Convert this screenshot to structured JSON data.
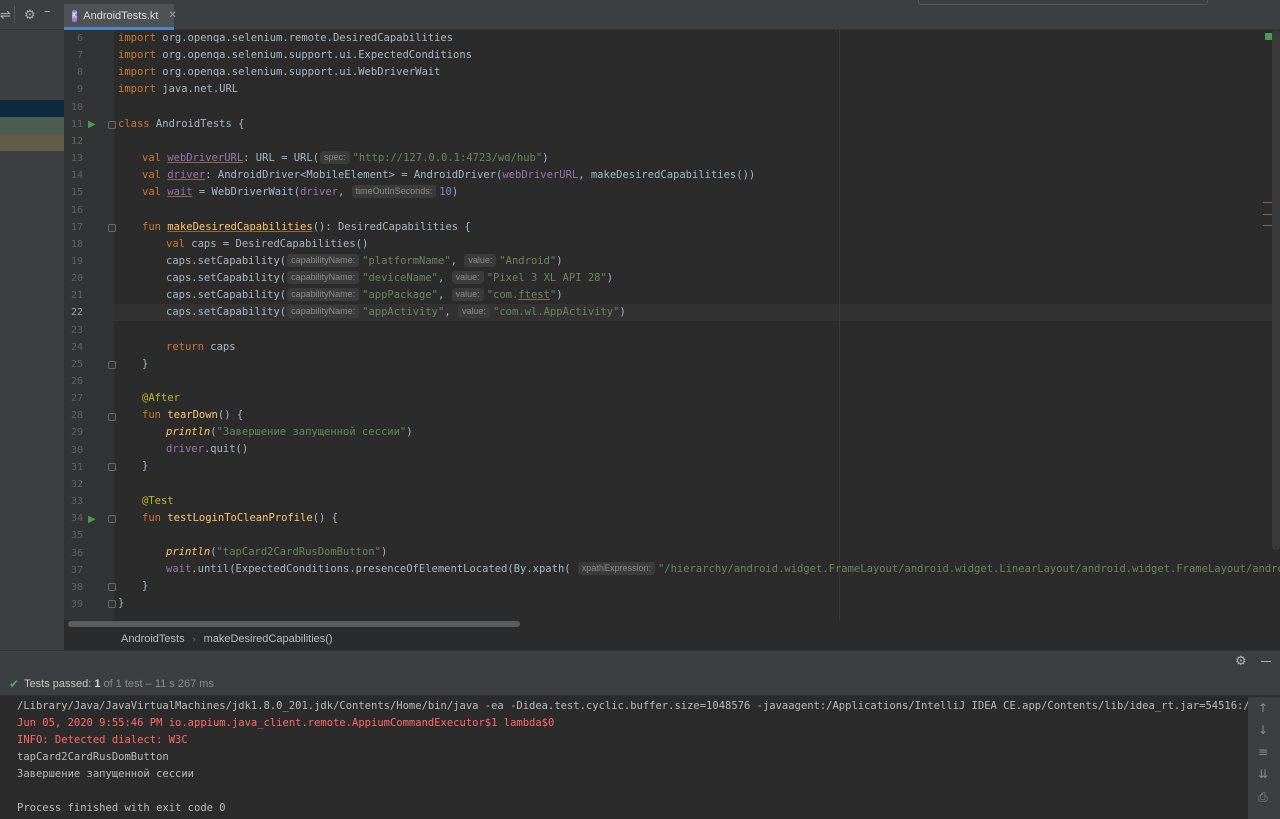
{
  "tab": {
    "file_name": "AndroidTests.kt",
    "icon": "kotlin-file-icon"
  },
  "editor": {
    "line_numbers": [
      "6",
      "7",
      "8",
      "9",
      "10",
      "11",
      "12",
      "13",
      "14",
      "15",
      "16",
      "17",
      "18",
      "19",
      "20",
      "21",
      "22",
      "23",
      "24",
      "25",
      "26",
      "27",
      "28",
      "29",
      "30",
      "31",
      "32",
      "33",
      "34",
      "35",
      "36",
      "37",
      "38",
      "39"
    ],
    "current_line": "22",
    "code": {
      "l6_import": "import",
      "l6_rest": " org.openqa.selenium.remote.DesiredCapabilities",
      "l7_rest": " org.openqa.selenium.support.ui.ExpectedConditions",
      "l8_rest": " org.openqa.selenium.support.ui.WebDriverWait",
      "l9_rest": " java.net.URL",
      "l11_class": "class",
      "l11_rest": " AndroidTests {",
      "val": "val",
      "fun": "fun",
      "l13_name": "webDriverURL",
      "l13_mid": ": URL = URL(",
      "l13_str": "\"http://127.0.0.1:4723/wd/hub\"",
      "l13_end": ")",
      "l14_name": "driver",
      "l14_mid": ": AndroidDriver<MobileElement> = AndroidDriver(",
      "l14_ref": "webDriverURL",
      "l14_end": ", makeDesiredCapabilities())",
      "l15_name": "wait",
      "l15_mid": " = WebDriverWait(",
      "l15_ref": "driver",
      "l15_comma": ", ",
      "l15_num": "10",
      "l15_end": ")",
      "l17_name": "makeDesiredCapabilities",
      "l17_end": "(): DesiredCapabilities {",
      "l18_rest": " caps = DesiredCapabilities()",
      "caps_set": "caps.setCapability(",
      "l19_k": "\"platformName\"",
      "l19_v": "\"Android\"",
      "l20_k": "\"deviceName\"",
      "l20_v": "\"Pixel 3 XL API 28\"",
      "l21_k": "\"appPackage\"",
      "l21_v_a": "\"com.",
      "l21_v_b": "ftest",
      "l21_v_c": "\"",
      "l22_k": "\"appActivity\"",
      "l22_v": "\"com.wl.AppActivity\"",
      "comma": ",",
      "close_paren": ")",
      "l24_return": "return",
      "l24_rest": " caps",
      "brace_close": "}",
      "l27_ann": "@After",
      "l28_name": "tearDown",
      "l28_end": "() {",
      "l29_fn": "println",
      "l29_rest": "(",
      "l29_str": "\"Завершение запущенной сессии\"",
      "l30_ref": "driver",
      "l30_rest": ".quit()",
      "l33_ann": "@Test",
      "l34_name": "testLoginToCleanProfile",
      "l34_end": "() {",
      "l36_fn": "println",
      "l36_str": "\"tapCard2CardRusDomButton\"",
      "l37_ref": "wait",
      "l37_mid": ".until(ExpectedConditions.presenceOfElementLocated(By.xpath(",
      "l37_str": "\"/hierarchy/android.widget.FrameLayout/android.widget.LinearLayout/android.widget.FrameLayout/android.widget"
    },
    "hints": {
      "spec": "spec:",
      "timeout": "timeOutInSeconds:",
      "capname": "capabilityName:",
      "value": "value:",
      "xpath": "xpathExpression:"
    }
  },
  "breadcrumb": {
    "class_name": "AndroidTests",
    "method_name": "makeDesiredCapabilities()"
  },
  "run_panel": {
    "status_label": "Tests passed:",
    "status_count": "1",
    "status_detail": "of 1 test – 11 s 267 ms",
    "console_lines": [
      "/Library/Java/JavaVirtualMachines/jdk1.8.0_201.jdk/Contents/Home/bin/java -ea -Didea.test.cyclic.buffer.size=1048576 -javaagent:/Applications/IntelliJ IDEA CE.app/Contents/lib/idea_rt.jar=54516:/Applicat",
      "Jun 05, 2020 9:55:46 PM io.appium.java_client.remote.AppiumCommandExecutor$1 lambda$0",
      "INFO: Detected dialect: W3C",
      "tapCard2CardRusDomButton",
      "Завершение запущенной сессии",
      "",
      "Process finished with exit code 0"
    ]
  },
  "colors": {
    "background": "#2b2b2b",
    "keyword": "#cc7832",
    "string": "#6a8759",
    "function": "#ffc66d",
    "error": "#ff6b68",
    "success": "#5ba55f"
  }
}
